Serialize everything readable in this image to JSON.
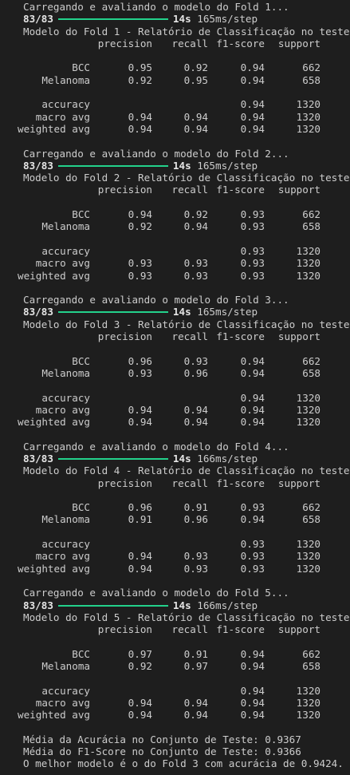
{
  "terminal": {
    "header_cols": [
      "precision",
      "recall",
      "f1-score",
      "support"
    ],
    "folds": [
      {
        "loading": "Carregando e avaliando o modelo do Fold 1...",
        "steps": "83/83",
        "time": "14s",
        "rate": "165ms/step",
        "report_title": "Modelo do Fold 1 - Relatório de Classificação no teste:",
        "rows": [
          {
            "label": "BCC",
            "precision": "0.95",
            "recall": "0.92",
            "f1": "0.94",
            "support": "662"
          },
          {
            "label": "Melanoma",
            "precision": "0.92",
            "recall": "0.95",
            "f1": "0.94",
            "support": "658"
          }
        ],
        "summary": [
          {
            "label": "accuracy",
            "precision": "",
            "recall": "",
            "f1": "0.94",
            "support": "1320"
          },
          {
            "label": "macro avg",
            "precision": "0.94",
            "recall": "0.94",
            "f1": "0.94",
            "support": "1320"
          },
          {
            "label": "weighted avg",
            "precision": "0.94",
            "recall": "0.94",
            "f1": "0.94",
            "support": "1320"
          }
        ]
      },
      {
        "loading": "Carregando e avaliando o modelo do Fold 2...",
        "steps": "83/83",
        "time": "14s",
        "rate": "165ms/step",
        "report_title": "Modelo do Fold 2 - Relatório de Classificação no teste:",
        "rows": [
          {
            "label": "BCC",
            "precision": "0.94",
            "recall": "0.92",
            "f1": "0.93",
            "support": "662"
          },
          {
            "label": "Melanoma",
            "precision": "0.92",
            "recall": "0.94",
            "f1": "0.93",
            "support": "658"
          }
        ],
        "summary": [
          {
            "label": "accuracy",
            "precision": "",
            "recall": "",
            "f1": "0.93",
            "support": "1320"
          },
          {
            "label": "macro avg",
            "precision": "0.93",
            "recall": "0.93",
            "f1": "0.93",
            "support": "1320"
          },
          {
            "label": "weighted avg",
            "precision": "0.93",
            "recall": "0.93",
            "f1": "0.93",
            "support": "1320"
          }
        ]
      },
      {
        "loading": "Carregando e avaliando o modelo do Fold 3...",
        "steps": "83/83",
        "time": "14s",
        "rate": "165ms/step",
        "report_title": "Modelo do Fold 3 - Relatório de Classificação no teste:",
        "rows": [
          {
            "label": "BCC",
            "precision": "0.96",
            "recall": "0.93",
            "f1": "0.94",
            "support": "662"
          },
          {
            "label": "Melanoma",
            "precision": "0.93",
            "recall": "0.96",
            "f1": "0.94",
            "support": "658"
          }
        ],
        "summary": [
          {
            "label": "accuracy",
            "precision": "",
            "recall": "",
            "f1": "0.94",
            "support": "1320"
          },
          {
            "label": "macro avg",
            "precision": "0.94",
            "recall": "0.94",
            "f1": "0.94",
            "support": "1320"
          },
          {
            "label": "weighted avg",
            "precision": "0.94",
            "recall": "0.94",
            "f1": "0.94",
            "support": "1320"
          }
        ]
      },
      {
        "loading": "Carregando e avaliando o modelo do Fold 4...",
        "steps": "83/83",
        "time": "14s",
        "rate": "166ms/step",
        "report_title": "Modelo do Fold 4 - Relatório de Classificação no teste:",
        "rows": [
          {
            "label": "BCC",
            "precision": "0.96",
            "recall": "0.91",
            "f1": "0.93",
            "support": "662"
          },
          {
            "label": "Melanoma",
            "precision": "0.91",
            "recall": "0.96",
            "f1": "0.94",
            "support": "658"
          }
        ],
        "summary": [
          {
            "label": "accuracy",
            "precision": "",
            "recall": "",
            "f1": "0.93",
            "support": "1320"
          },
          {
            "label": "macro avg",
            "precision": "0.94",
            "recall": "0.93",
            "f1": "0.93",
            "support": "1320"
          },
          {
            "label": "weighted avg",
            "precision": "0.94",
            "recall": "0.93",
            "f1": "0.93",
            "support": "1320"
          }
        ]
      },
      {
        "loading": "Carregando e avaliando o modelo do Fold 5...",
        "steps": "83/83",
        "time": "14s",
        "rate": "166ms/step",
        "report_title": "Modelo do Fold 5 - Relatório de Classificação no teste:",
        "rows": [
          {
            "label": "BCC",
            "precision": "0.97",
            "recall": "0.91",
            "f1": "0.94",
            "support": "662"
          },
          {
            "label": "Melanoma",
            "precision": "0.92",
            "recall": "0.97",
            "f1": "0.94",
            "support": "658"
          }
        ],
        "summary": [
          {
            "label": "accuracy",
            "precision": "",
            "recall": "",
            "f1": "0.94",
            "support": "1320"
          },
          {
            "label": "macro avg",
            "precision": "0.94",
            "recall": "0.94",
            "f1": "0.94",
            "support": "1320"
          },
          {
            "label": "weighted avg",
            "precision": "0.94",
            "recall": "0.94",
            "f1": "0.94",
            "support": "1320"
          }
        ]
      }
    ],
    "final_lines": [
      "Média da Acurácia no Conjunto de Teste: 0.9367",
      "Média do F1-Score no Conjunto de Teste: 0.9366",
      "O melhor modelo é o do Fold 3 com acurácia de 0.9424."
    ],
    "progress_bar_color": "#23d18b",
    "background_color": "#1e1e1e",
    "text_color": "#cccccc"
  }
}
